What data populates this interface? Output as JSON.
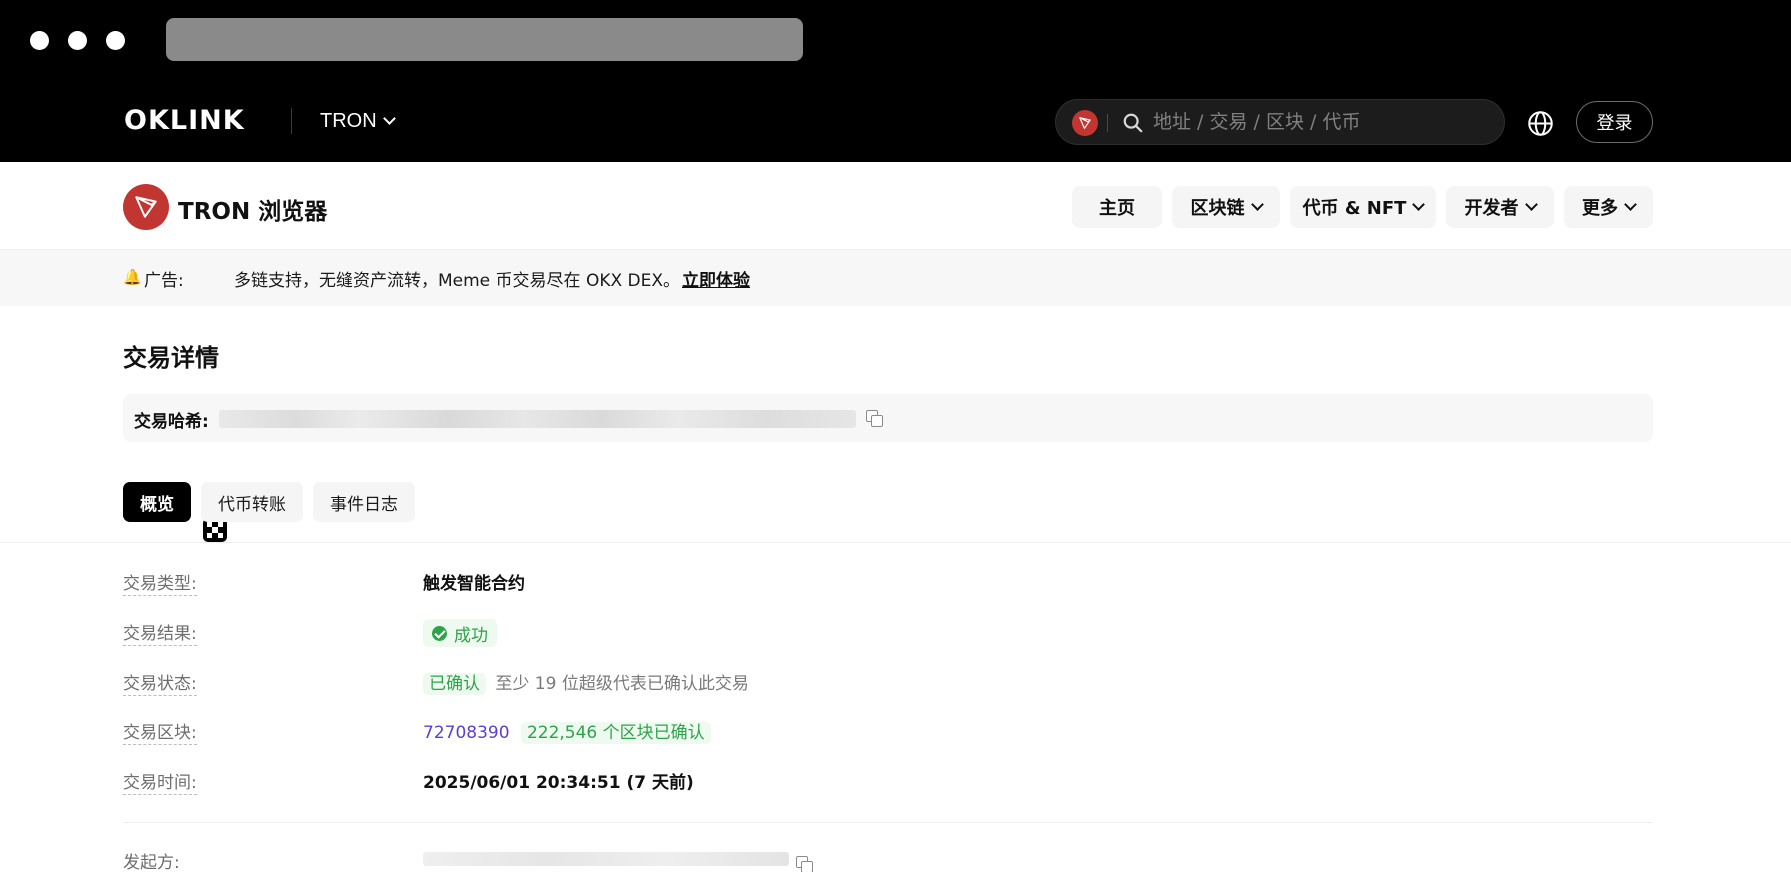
{
  "logo": {
    "text": "OKLINK"
  },
  "chain_selector": {
    "label": "TRON"
  },
  "search": {
    "placeholder": "地址 / 交易 / 区块 / 代币"
  },
  "login_label": "登录",
  "brand": {
    "name": "TRON 浏览器"
  },
  "nav": [
    {
      "label": "主页"
    },
    {
      "label": "区块链"
    },
    {
      "label": "代币 & NFT"
    },
    {
      "label": "开发者"
    },
    {
      "label": "更多"
    }
  ],
  "ad": {
    "label": "广告:",
    "text": "多链支持，无缝资产流转，Meme 币交易尽在 OKX DEX。",
    "link": "立即体验"
  },
  "page_title": "交易详情",
  "hash": {
    "label": "交易哈希:"
  },
  "tabs": [
    {
      "label": "概览",
      "active": true
    },
    {
      "label": "代币转账",
      "active": false
    },
    {
      "label": "事件日志",
      "active": false
    }
  ],
  "details": {
    "type": {
      "label": "交易类型:",
      "value": "触发智能合约"
    },
    "result": {
      "label": "交易结果:",
      "value": "成功"
    },
    "status": {
      "label": "交易状态:",
      "value": "已确认",
      "note": "至少 19 位超级代表已确认此交易"
    },
    "block": {
      "label": "交易区块:",
      "value": "72708390",
      "confirmations": "222,546 个区块已确认"
    },
    "time": {
      "label": "交易时间:",
      "value": "2025/06/01 20:34:51 (7 天前)"
    },
    "from": {
      "label": "发起方:"
    }
  },
  "colors": {
    "tron_red": "#c23631",
    "success_green": "#2fa34a",
    "block_link_purple": "#5b3fd1"
  }
}
